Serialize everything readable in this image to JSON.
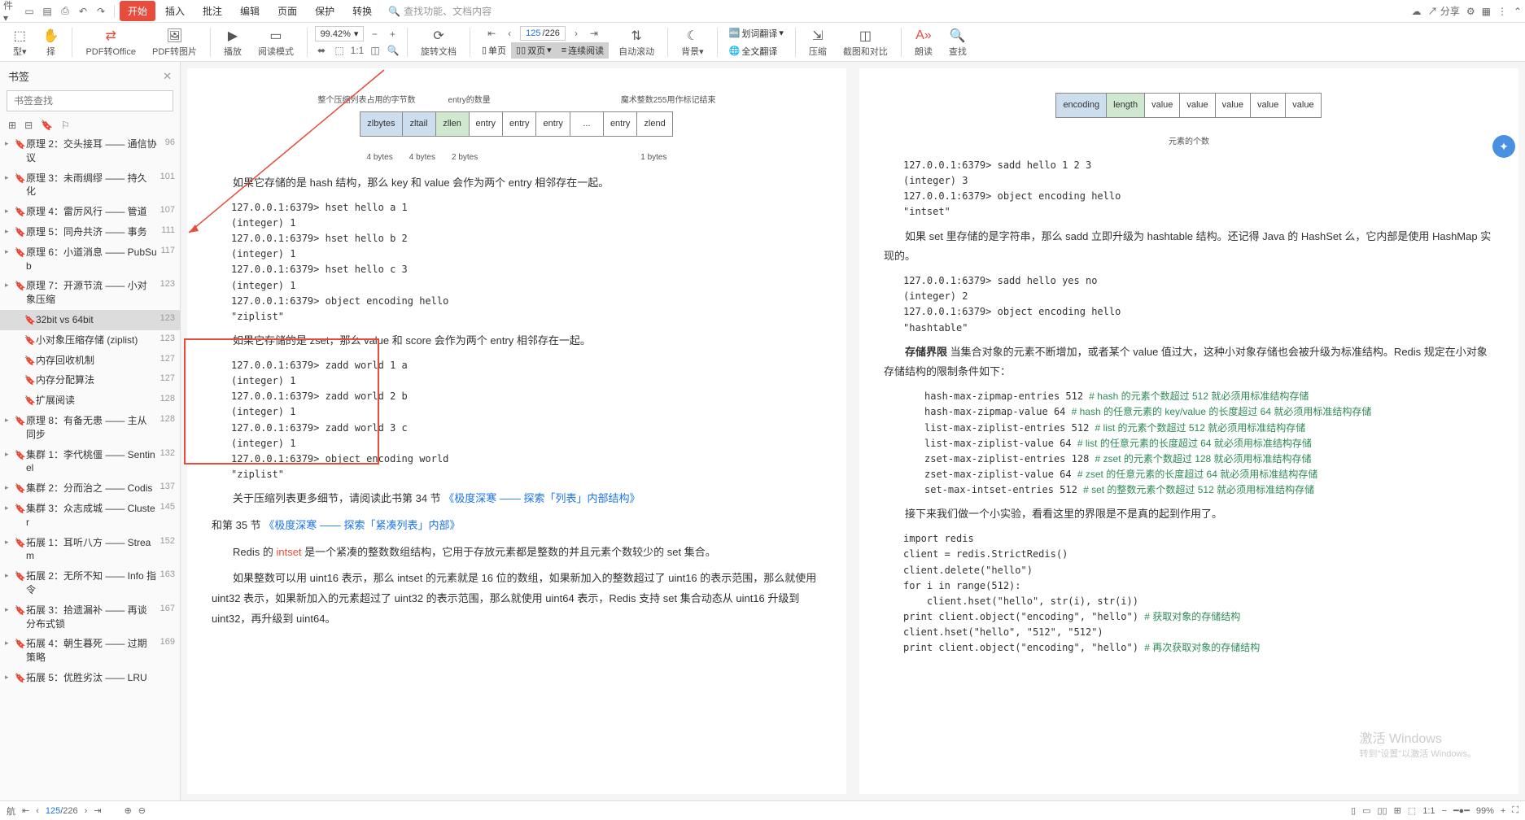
{
  "menubar": {
    "tabs": [
      "开始",
      "插入",
      "批注",
      "编辑",
      "页面",
      "保护",
      "转换"
    ],
    "search_placeholder": "查找功能、文档内容",
    "share": "分享"
  },
  "toolbar": {
    "pdf2office": "PDF转Office",
    "pdf2img": "PDF转图片",
    "play": "播放",
    "readmode": "阅读模式",
    "zoom_value": "99.42%",
    "rotate": "旋转文档",
    "page_current": "125",
    "page_total": "/226",
    "single": "单页",
    "double": "双页",
    "continuous": "连续阅读",
    "autoroll": "自动滚动",
    "background": "背景",
    "huacixuanci": "划词翻译",
    "fulltrans": "全文翻译",
    "compress": "压缩",
    "compare": "截图和对比",
    "read_aloud": "朗读",
    "find": "查找"
  },
  "sidebar": {
    "title": "书签",
    "search_placeholder": "书签查找",
    "items": [
      {
        "label": "原理 2：交头接耳 —— 通信协议",
        "page": "96"
      },
      {
        "label": "原理 3：未雨绸缪 —— 持久化",
        "page": "101"
      },
      {
        "label": "原理 4：雷厉风行 —— 管道",
        "page": "107"
      },
      {
        "label": "原理 5：同舟共济 —— 事务",
        "page": "111"
      },
      {
        "label": "原理 6：小道消息 —— PubSub",
        "page": "117"
      },
      {
        "label": "原理 7：开源节流 —— 小对象压缩",
        "page": "123"
      },
      {
        "label": "32bit vs 64bit",
        "page": "123",
        "child": true,
        "selected": true
      },
      {
        "label": "小对象压缩存储 (ziplist)",
        "page": "123",
        "child": true
      },
      {
        "label": "内存回收机制",
        "page": "127",
        "child": true
      },
      {
        "label": "内存分配算法",
        "page": "127",
        "child": true
      },
      {
        "label": "扩展阅读",
        "page": "128",
        "child": true
      },
      {
        "label": "原理 8：有备无患 —— 主从同步",
        "page": "128"
      },
      {
        "label": "集群 1：李代桃僵 —— Sentinel",
        "page": "132"
      },
      {
        "label": "集群 2：分而治之 —— Codis",
        "page": "137"
      },
      {
        "label": "集群 3：众志成城 —— Cluster",
        "page": "145"
      },
      {
        "label": "拓展 1：耳听八方 —— Stream",
        "page": "152"
      },
      {
        "label": "拓展 2：无所不知 —— Info 指令",
        "page": "163"
      },
      {
        "label": "拓展 3：拾遗漏补 —— 再谈分布式锁",
        "page": "167"
      },
      {
        "label": "拓展 4：朝生暮死 —— 过期策略",
        "page": "169"
      },
      {
        "label": "拓展 5：优胜劣汰 —— LRU",
        "page": ""
      }
    ]
  },
  "page_left": {
    "diagram_labels": {
      "l1": "整个压缩列表占用的字节数",
      "l2": "entry的数量",
      "l3": "魔术整数255用作标记结束",
      "below": [
        "4 bytes",
        "4 bytes",
        "2 bytes",
        "1 bytes"
      ]
    },
    "diagram_cells": [
      "zlbytes",
      "zltail",
      "zllen",
      "entry",
      "entry",
      "entry",
      "...",
      "entry",
      "zlend"
    ],
    "p1": "如果它存储的是 hash 结构，那么 key 和 value 会作为两个 entry 相邻存在一起。",
    "code1": [
      "127.0.0.1:6379> hset hello a 1",
      "(integer) 1",
      "127.0.0.1:6379> hset hello b 2",
      "(integer) 1",
      "127.0.0.1:6379> hset hello c 3",
      "(integer) 1",
      "127.0.0.1:6379> object encoding hello",
      "\"ziplist\""
    ],
    "p2": "如果它存储的是 zset，那么 value 和 score 会作为两个 entry 相邻存在一起。",
    "code2": [
      "127.0.0.1:6379> zadd world 1 a",
      "(integer) 1",
      "127.0.0.1:6379> zadd world 2 b",
      "(integer) 1",
      "127.0.0.1:6379> zadd world 3 c",
      "(integer) 1",
      "127.0.0.1:6379> object encoding world",
      "\"ziplist\""
    ],
    "p3a": "关于压缩列表更多细节，请阅读此书第 34 节 ",
    "p3b": "《极度深寒 —— 探索「列表」内部结构》",
    "p3c": "和第 35 节 ",
    "p3d": "《极度深寒 —— 探索「紧凑列表」内部》",
    "p4a": "Redis 的 ",
    "p4b": "intset",
    "p4c": " 是一个紧凑的整数数组结构，它用于存放元素都是整数的并且元素个数较少的 set 集合。",
    "p5": "如果整数可以用 uint16 表示，那么 intset 的元素就是 16 位的数组，如果新加入的整数超过了 uint16 的表示范围，那么就使用 uint32 表示，如果新加入的元素超过了 uint32 的表示范围，那么就使用 uint64 表示，Redis 支持 set 集合动态从 uint16 升级到 uint32，再升级到 uint64。"
  },
  "page_right": {
    "diagram_cells": [
      "encoding",
      "length",
      "value",
      "value",
      "value",
      "value",
      "value"
    ],
    "diagram_label": "元素的个数",
    "code1": [
      "127.0.0.1:6379> sadd hello 1 2 3",
      "(integer) 3",
      "127.0.0.1:6379> object encoding hello",
      "\"intset\""
    ],
    "p1": "如果 set 里存储的是字符串，那么 sadd 立即升级为 hashtable 结构。还记得 Java 的 HashSet 么，它内部是使用 HashMap 实现的。",
    "code2": [
      "127.0.0.1:6379> sadd hello yes no",
      "(integer) 2",
      "127.0.0.1:6379> object encoding hello",
      "\"hashtable\""
    ],
    "p2a": "存储界限",
    "p2b": "   当集合对象的元素不断增加，或者某个 value 值过大，这种小对象存储也会被升级为标准结构。Redis 规定在小对象存储结构的限制条件如下：",
    "configs": [
      {
        "k": "hash-max-zipmap-entries 512",
        "c": "# hash 的元素个数超过 512 就必须用标准结构存储"
      },
      {
        "k": "hash-max-zipmap-value 64",
        "c": "# hash 的任意元素的 key/value 的长度超过 64 就必须用标准结构存储"
      },
      {
        "k": "list-max-ziplist-entries 512",
        "c": "# list 的元素个数超过 512 就必须用标准结构存储"
      },
      {
        "k": "list-max-ziplist-value 64",
        "c": "# list 的任意元素的长度超过 64 就必须用标准结构存储"
      },
      {
        "k": "zset-max-ziplist-entries 128",
        "c": "# zset 的元素个数超过 128 就必须用标准结构存储"
      },
      {
        "k": "zset-max-ziplist-value 64",
        "c": "# zset 的任意元素的长度超过 64 就必须用标准结构存储"
      },
      {
        "k": "set-max-intset-entries 512",
        "c": "# set 的整数元素个数超过 512 就必须用标准结构存储"
      }
    ],
    "p3": "接下来我们做一个小实验，看看这里的界限是不是真的起到作用了。",
    "code3": [
      {
        "t": "import redis"
      },
      {
        "t": "client = redis.StrictRedis()"
      },
      {
        "t": "client.delete(\"hello\")"
      },
      {
        "t": "for i in range(512):"
      },
      {
        "t": "    client.hset(\"hello\", str(i), str(i))"
      },
      {
        "t": "print client.object(\"encoding\", \"hello\")",
        "c": "# 获取对象的存储结构"
      },
      {
        "t": "client.hset(\"hello\", \"512\", \"512\")"
      },
      {
        "t": "print client.object(\"encoding\", \"hello\")",
        "c": "# 再次获取对象的存储结构"
      }
    ]
  },
  "watermark": {
    "l1": "激活 Windows",
    "l2": "转到\"设置\"以激活 Windows。"
  },
  "statusbar": {
    "page_cur": "125",
    "page_total": "/226",
    "zoom": "99%"
  }
}
